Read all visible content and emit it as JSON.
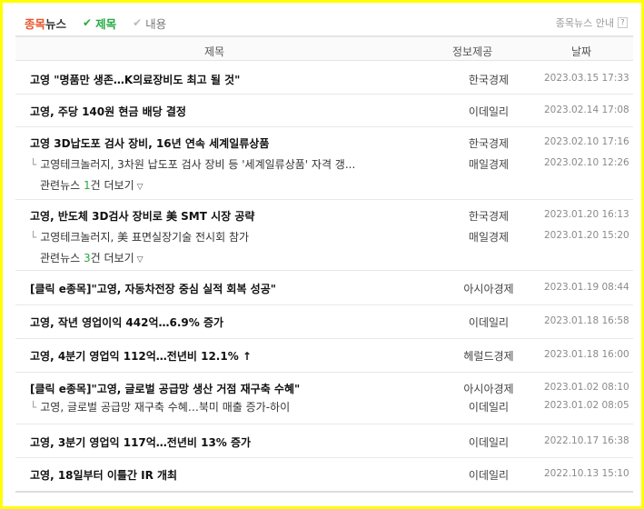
{
  "tabs": {
    "main_accent": "종목",
    "main_rest": "뉴스",
    "title_opt": "제목",
    "content_opt": "내용",
    "check_glyph": "✔"
  },
  "guide": {
    "label": "종목뉴스 안내",
    "help": "?"
  },
  "header": {
    "title": "제목",
    "source": "정보제공",
    "date": "날짜"
  },
  "related_prefix": "관련뉴스",
  "related_suffix": "건 더보기",
  "news": [
    {
      "title": "고영 \"명품만 생존…K의료장비도 최고 될 것\"",
      "source": "한국경제",
      "date": "2023.03.15 17:33"
    },
    {
      "title": "고영, 주당 140원 현금 배당 결정",
      "source": "이데일리",
      "date": "2023.02.14 17:08"
    },
    {
      "title": "고영 3D납도포 검사 장비, 16년 연속 세계일류상품",
      "source": "한국경제",
      "date": "2023.02.10 17:16",
      "related": {
        "title": "고영테크놀러지, 3차원 납도포 검사 장비 등 '세계일류상품' 자격 갱...",
        "source": "매일경제",
        "date": "2023.02.10 12:26"
      },
      "related_count": "1"
    },
    {
      "title": "고영, 반도체 3D검사 장비로 美 SMT 시장 공략",
      "source": "한국경제",
      "date": "2023.01.20 16:13",
      "related": {
        "title": "고영테크놀러지, 美 표면실장기술 전시회 참가",
        "source": "매일경제",
        "date": "2023.01.20 15:20"
      },
      "related_count": "3"
    },
    {
      "title": "[클릭 e종목]\"고영, 자동차전장 중심 실적 회복 성공\"",
      "source": "아시아경제",
      "date": "2023.01.19 08:44"
    },
    {
      "title": "고영, 작년 영업이익 442억…6.9% 증가",
      "source": "이데일리",
      "date": "2023.01.18 16:58"
    },
    {
      "title": "고영, 4분기 영업익 112억…전년비 12.1% ↑",
      "source": "헤럴드경제",
      "date": "2023.01.18 16:00"
    },
    {
      "title": "[클릭 e종목]\"고영, 글로벌 공급망 생산 거점 재구축 수혜\"",
      "source": "아시아경제",
      "date": "2023.01.02 08:10",
      "related": {
        "title": "고영, 글로벌 공급망 재구축 수혜…북미 매출 증가-하이",
        "source": "이데일리",
        "date": "2023.01.02 08:05"
      }
    },
    {
      "title": "고영, 3분기 영업익 117억…전년비 13% 증가",
      "source": "이데일리",
      "date": "2022.10.17 16:38"
    },
    {
      "title": "고영, 18일부터 이틀간 IR 개최",
      "source": "이데일리",
      "date": "2022.10.13 15:10"
    }
  ]
}
